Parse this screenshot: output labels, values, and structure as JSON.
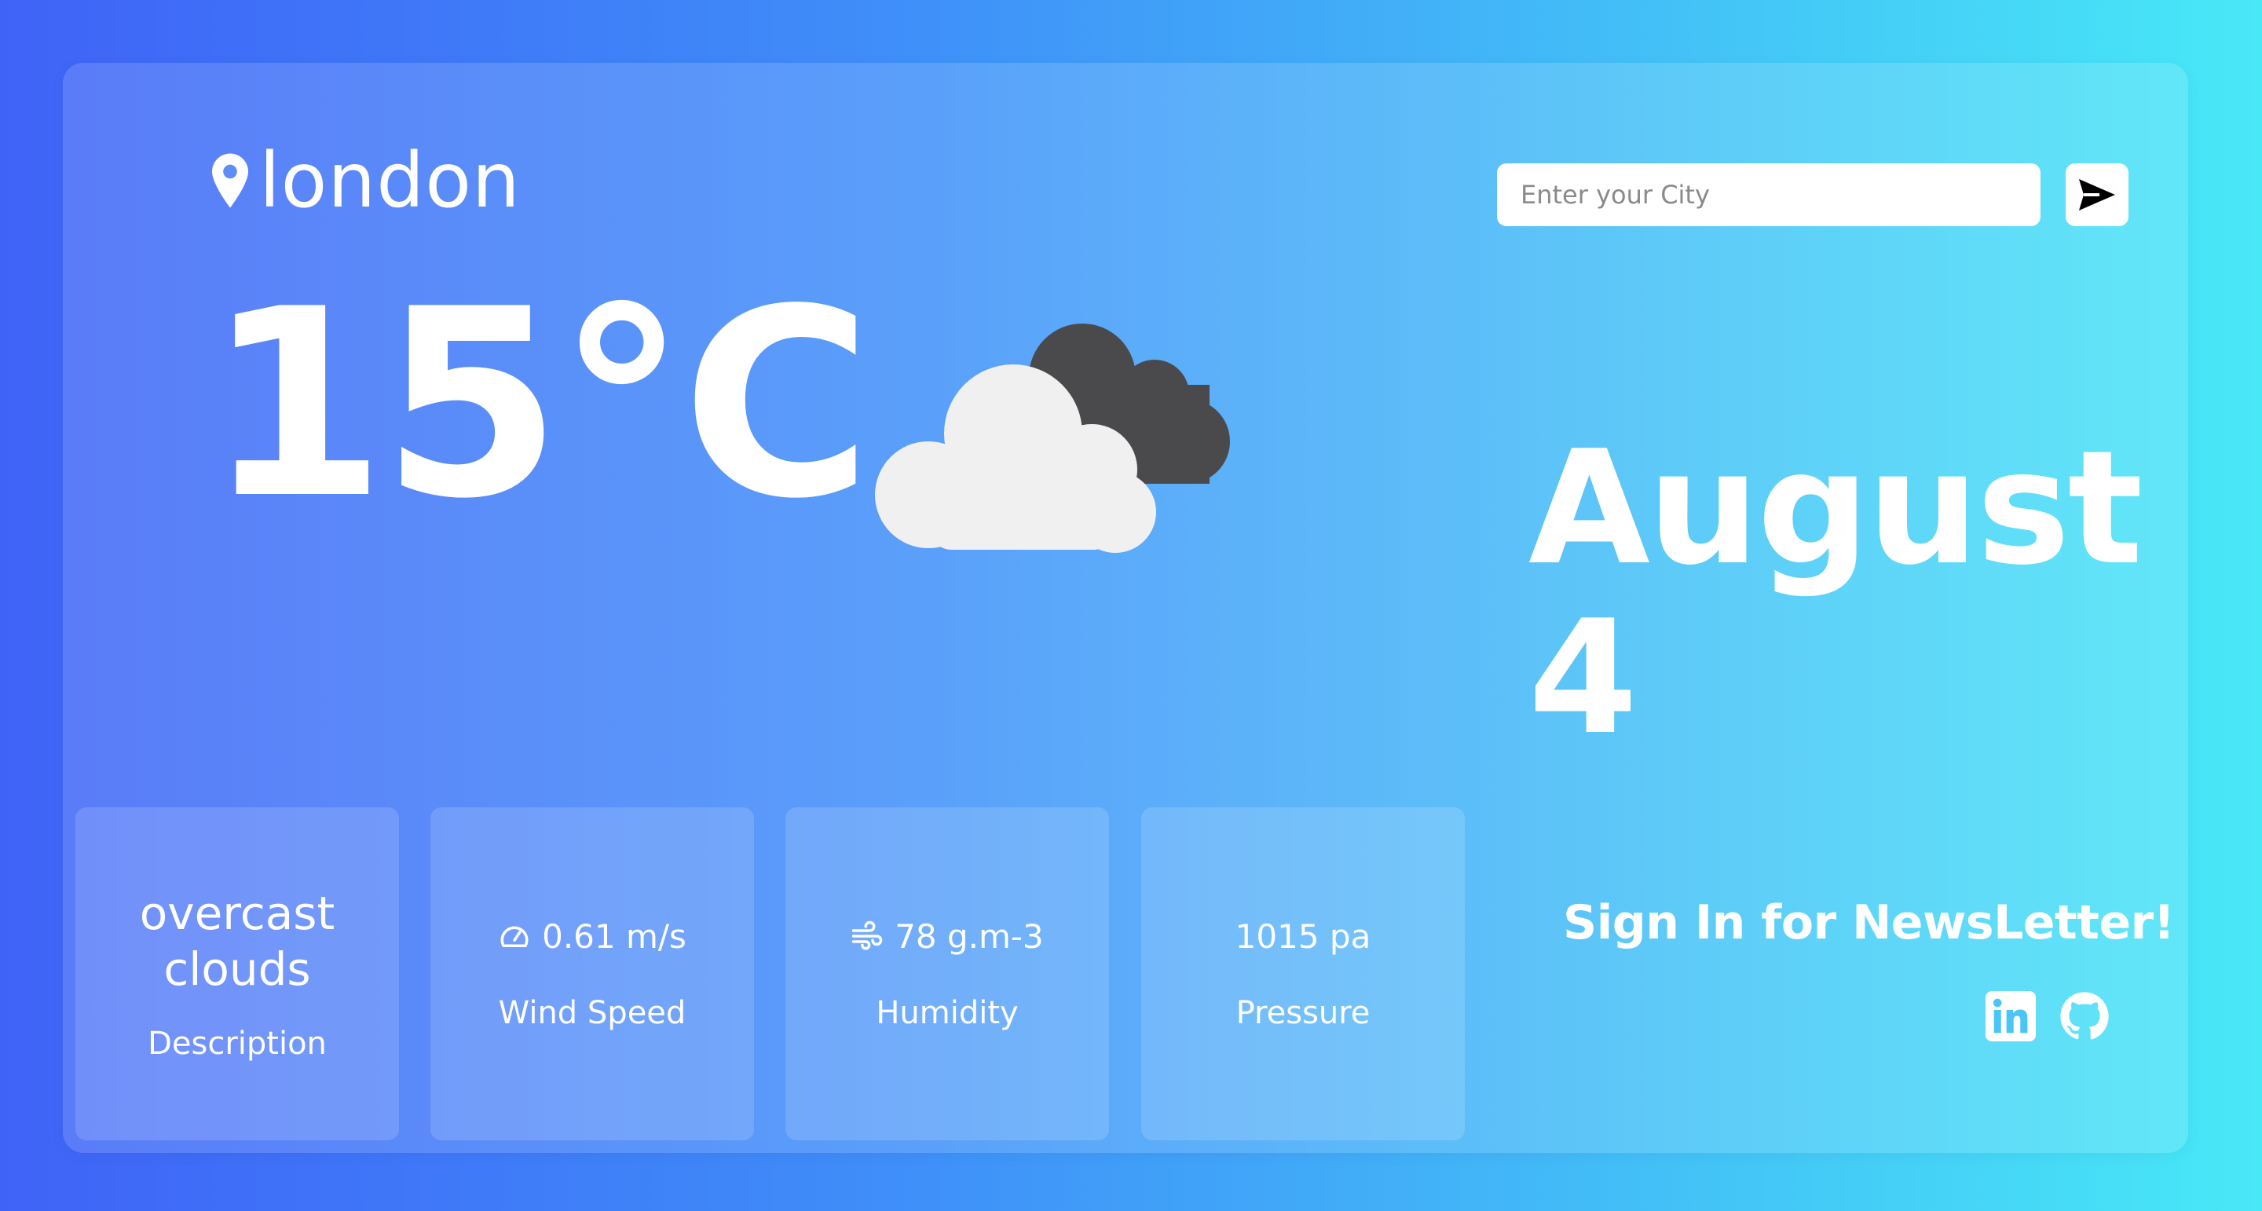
{
  "location": {
    "city": "london",
    "icon": "location-pin-icon"
  },
  "current": {
    "temperature": "15°C",
    "icon": "overcast-clouds-icon"
  },
  "search": {
    "placeholder": "Enter your City",
    "value": "",
    "icon": "send-icon"
  },
  "date": {
    "month": "August",
    "day": "4"
  },
  "stats": {
    "description": {
      "value_line1": "overcast",
      "value_line2": "clouds",
      "label": "Description"
    },
    "wind": {
      "value": "0.61 m/s",
      "label": "Wind Speed",
      "icon": "speedometer-icon"
    },
    "humidity": {
      "value": "78 g.m-3",
      "label": "Humidity",
      "icon": "wind-icon"
    },
    "pressure": {
      "value": "1015 pa",
      "label": "Pressure"
    }
  },
  "newsletter": {
    "text": "Sign In for NewsLetter!"
  },
  "socials": [
    {
      "icon": "linkedin-icon"
    },
    {
      "icon": "github-icon"
    }
  ],
  "colors": {
    "gradient_start": "#3f63f7",
    "gradient_end": "#48e8f7",
    "cloud_front": "#f0f0f0",
    "cloud_back": "#4a4a4d"
  }
}
